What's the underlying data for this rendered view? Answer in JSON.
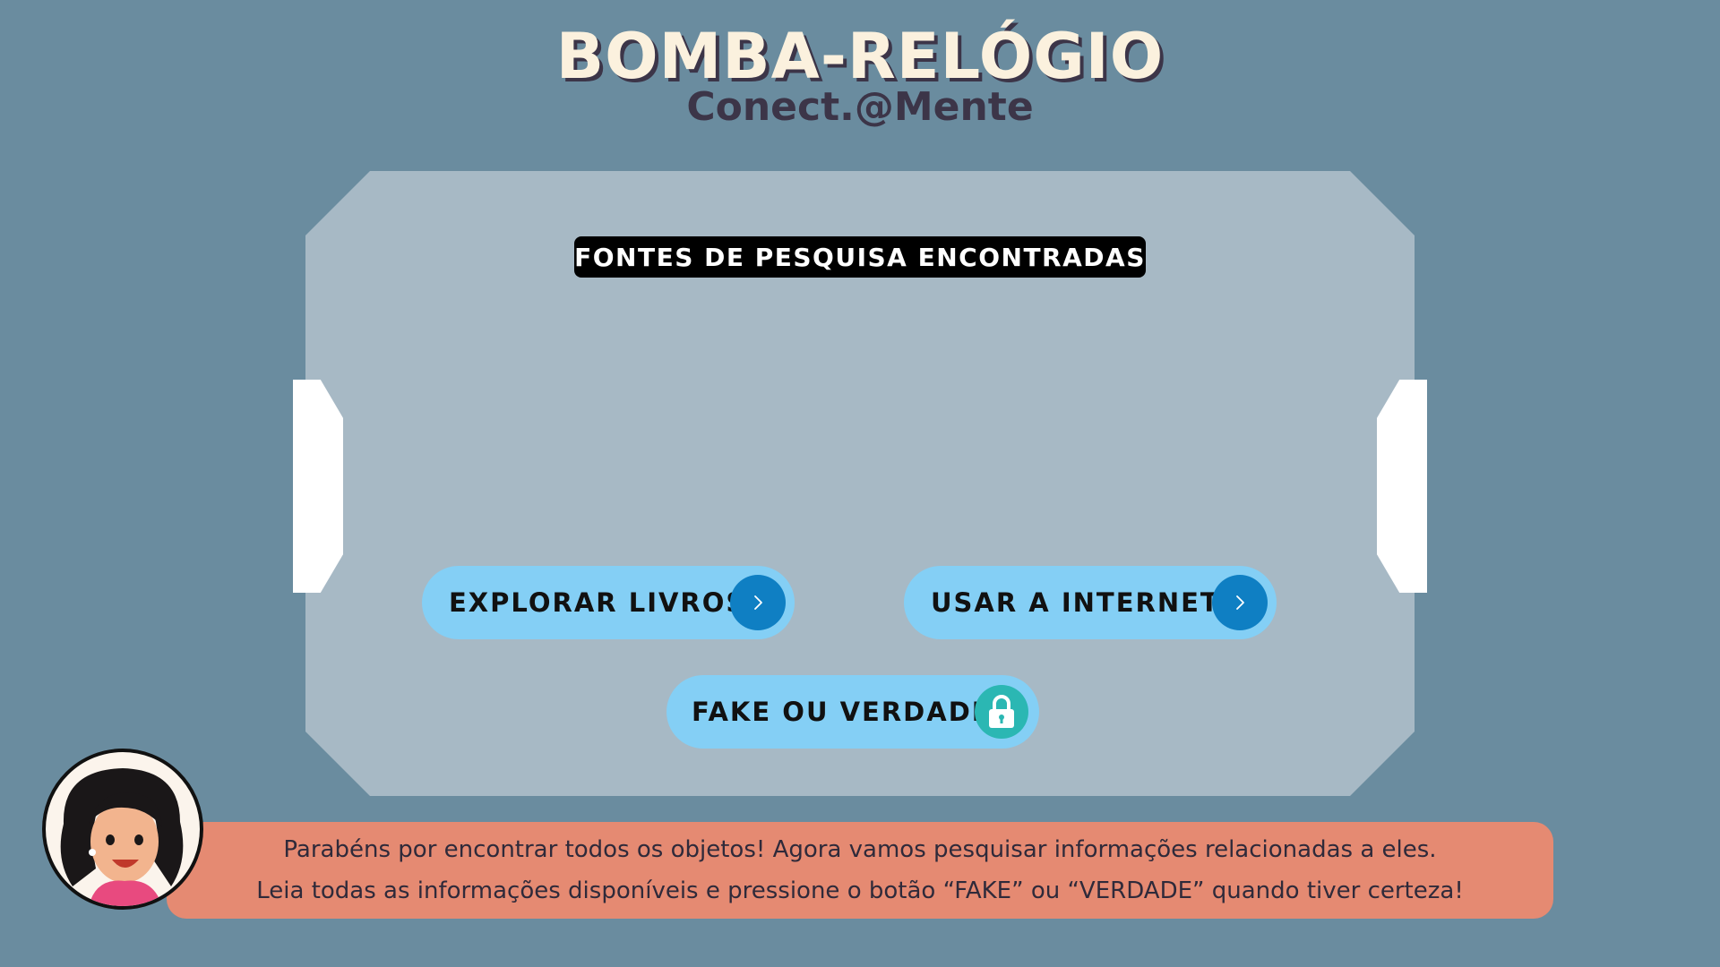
{
  "header": {
    "title": "BOMBA-RELÓGIO",
    "subtitle": "Conect.@Mente"
  },
  "panel": {
    "section_label": "FONTES DE PESQUISA ENCONTRADAS",
    "buttons": [
      {
        "label": "EXPLORAR LIVROS",
        "icon": "chevron-right-icon"
      },
      {
        "label": "USAR A INTERNET",
        "icon": "chevron-right-icon"
      },
      {
        "label": "FAKE OU VERDADE",
        "icon": "lock-icon"
      }
    ]
  },
  "dialog": {
    "line1": "Parabéns por encontrar todos os objetos! Agora vamos pesquisar informações relacionadas a eles.",
    "line2": "Leia todas as informações disponíveis e pressione o botão “FAKE” ou “VERDADE” quando tiver certeza!"
  },
  "colors": {
    "background": "#6a8c9f",
    "panel": "#a7b9c5",
    "button": "#84cff5",
    "button_icon": "#0f7fc3",
    "lock_icon": "#2bb7b3",
    "speech_bubble": "#e58a72",
    "title": "#fbf1de"
  }
}
